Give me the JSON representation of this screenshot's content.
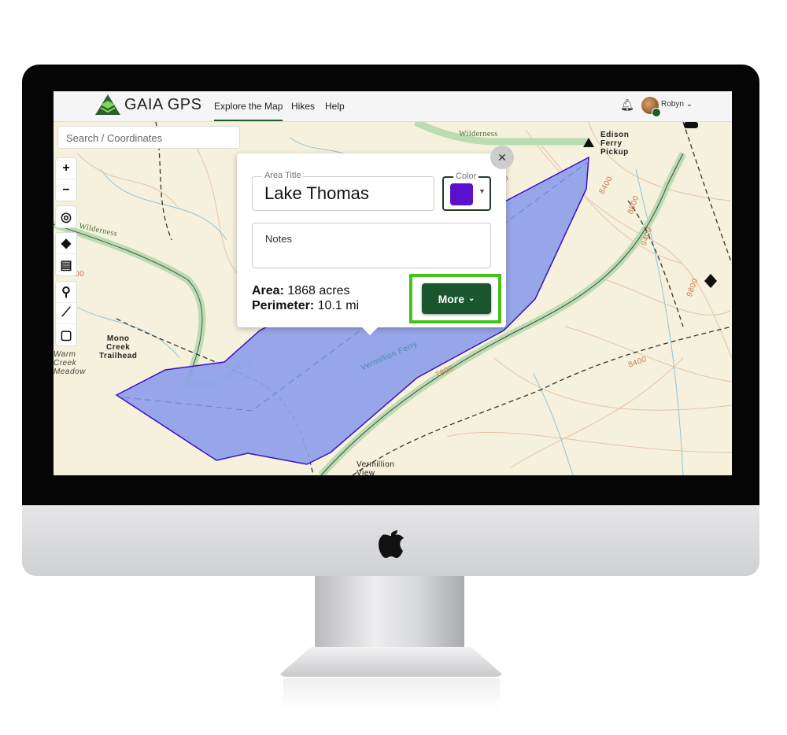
{
  "app": {
    "brand": "GAIA GPS",
    "nav": [
      {
        "label": "Explore the Map",
        "active": true
      },
      {
        "label": "Hikes"
      },
      {
        "label": "Help"
      }
    ],
    "user": "Robyn",
    "accent": "#1f5c2c"
  },
  "search": {
    "placeholder": "Search / Coordinates"
  },
  "toolbar": [
    {
      "icon": "zoom-in-icon",
      "glyph": "+"
    },
    {
      "icon": "zoom-out-icon",
      "glyph": "−"
    },
    {
      "icon": "locate-icon",
      "glyph": "◎"
    },
    {
      "icon": "layers-icon",
      "glyph": "◆"
    },
    {
      "icon": "print-icon",
      "glyph": "▤"
    },
    {
      "icon": "waypoint-icon",
      "glyph": "⚲"
    },
    {
      "icon": "route-icon",
      "glyph": "⟋"
    },
    {
      "icon": "area-icon",
      "glyph": "▢"
    }
  ],
  "map_labels": {
    "edison": "Edison\nFerry\nPickup",
    "mono": "Mono\nCreek\nTrailhead",
    "warm": "Warm\nCreek\nMeadow",
    "vermillion_view": "Vermillion\nView",
    "ferry": "Vermillion Ferry",
    "wilderness": "Wilderness",
    "wilderness2": "Wilderness",
    "contours": [
      "7800",
      "8400",
      "7800",
      "8400",
      "8800",
      "9400",
      "9800",
      "8800"
    ]
  },
  "popup": {
    "title_label": "Area Title",
    "title_value": "Lake Thomas",
    "color_label": "Color",
    "color": "#5b10cc",
    "notes_placeholder": "Notes",
    "area_label": "Area:",
    "area_value": "1868 acres",
    "perimeter_label": "Perimeter:",
    "perimeter_value": "10.1 mi",
    "more_label": "More",
    "highlight_color": "#44c21a"
  },
  "polygon_fill": "#8e9fe8"
}
